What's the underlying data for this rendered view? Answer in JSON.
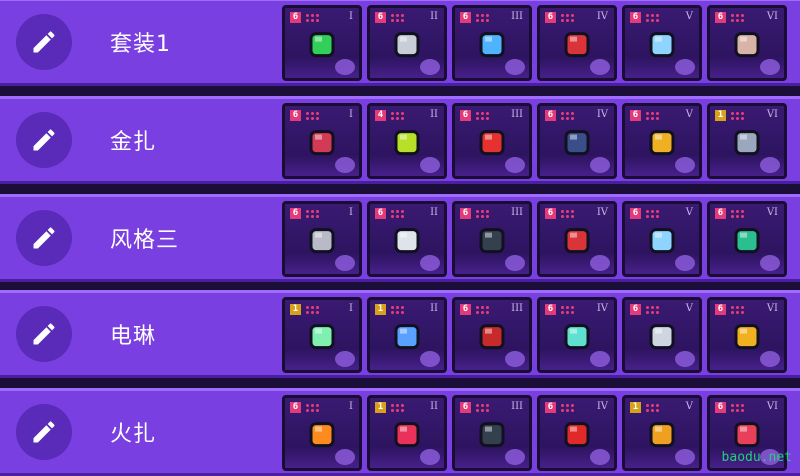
{
  "loadouts": [
    {
      "name": "套装1",
      "slots": [
        {
          "rank": "I",
          "badge": "6",
          "item_icon": "green-cube-icon",
          "color": "#32d05a"
        },
        {
          "rank": "II",
          "badge": "6",
          "item_icon": "silver-coin-icon",
          "color": "#c9cdd6"
        },
        {
          "rank": "III",
          "badge": "6",
          "item_icon": "amulet-icon",
          "color": "#4fb3ff"
        },
        {
          "rank": "IV",
          "badge": "6",
          "item_icon": "umbrella-logo-icon",
          "color": "#d9343a"
        },
        {
          "rank": "V",
          "badge": "6",
          "item_icon": "document-icon",
          "color": "#8fd3ff"
        },
        {
          "rank": "VI",
          "badge": "6",
          "item_icon": "brain-jar-icon",
          "color": "#d7b3a8"
        }
      ]
    },
    {
      "name": "金扎",
      "slots": [
        {
          "rank": "I",
          "badge": "6",
          "item_icon": "shield-orb-icon",
          "color": "#d23a55"
        },
        {
          "rank": "II",
          "badge": "4",
          "item_icon": "slime-icon",
          "color": "#b8e028"
        },
        {
          "rank": "III",
          "badge": "6",
          "item_icon": "red-arrow-icon",
          "color": "#e53230"
        },
        {
          "rank": "IV",
          "badge": "6",
          "item_icon": "bombs-icon",
          "color": "#3a4f8a"
        },
        {
          "rank": "V",
          "badge": "6",
          "item_icon": "gold-pyramid-icon",
          "color": "#f0b023"
        },
        {
          "rank": "VI",
          "badge": "1",
          "item_icon": "vial-icon",
          "color": "#9aa7bd"
        }
      ]
    },
    {
      "name": "风格三",
      "slots": [
        {
          "rank": "I",
          "badge": "6",
          "item_icon": "gauntlet-icon",
          "color": "#b9b9c7"
        },
        {
          "rank": "II",
          "badge": "6",
          "item_icon": "armor-icon",
          "color": "#dfe3ea"
        },
        {
          "rank": "III",
          "badge": "6",
          "item_icon": "telephone-icon",
          "color": "#34404e"
        },
        {
          "rank": "IV",
          "badge": "6",
          "item_icon": "umbrella-logo-icon",
          "color": "#d9343a"
        },
        {
          "rank": "V",
          "badge": "6",
          "item_icon": "document-icon",
          "color": "#8fd3ff"
        },
        {
          "rank": "VI",
          "badge": "6",
          "item_icon": "battery-pack-icon",
          "color": "#2bbf8f"
        }
      ]
    },
    {
      "name": "电琳",
      "slots": [
        {
          "rank": "I",
          "badge": "1",
          "item_icon": "crystal-flower-icon",
          "color": "#7ff0b0"
        },
        {
          "rank": "II",
          "badge": "1",
          "item_icon": "capsule-icon",
          "color": "#5aa0ff"
        },
        {
          "rank": "III",
          "badge": "6",
          "item_icon": "red-glove-icon",
          "color": "#c62a2a"
        },
        {
          "rank": "IV",
          "badge": "6",
          "item_icon": "crystal-burst-icon",
          "color": "#5fe0d0"
        },
        {
          "rank": "V",
          "badge": "6",
          "item_icon": "bullet-icon",
          "color": "#cfd6e2"
        },
        {
          "rank": "VI",
          "badge": "6",
          "item_icon": "battery-icon",
          "color": "#f0b020"
        }
      ]
    },
    {
      "name": "火扎",
      "slots": [
        {
          "rank": "I",
          "badge": "6",
          "item_icon": "fire-swirl-icon",
          "color": "#ff8a1e"
        },
        {
          "rank": "II",
          "badge": "1",
          "item_icon": "lips-icon",
          "color": "#e8325a"
        },
        {
          "rank": "III",
          "badge": "6",
          "item_icon": "telephone-icon",
          "color": "#34404e"
        },
        {
          "rank": "IV",
          "badge": "6",
          "item_icon": "red-blade-icon",
          "color": "#e02a2a"
        },
        {
          "rank": "V",
          "badge": "1",
          "item_icon": "flame-sword-icon",
          "color": "#f0a020"
        },
        {
          "rank": "VI",
          "badge": "6",
          "item_icon": "controller-icon",
          "color": "#e8405a"
        }
      ]
    }
  ],
  "watermark": "baodu.net"
}
